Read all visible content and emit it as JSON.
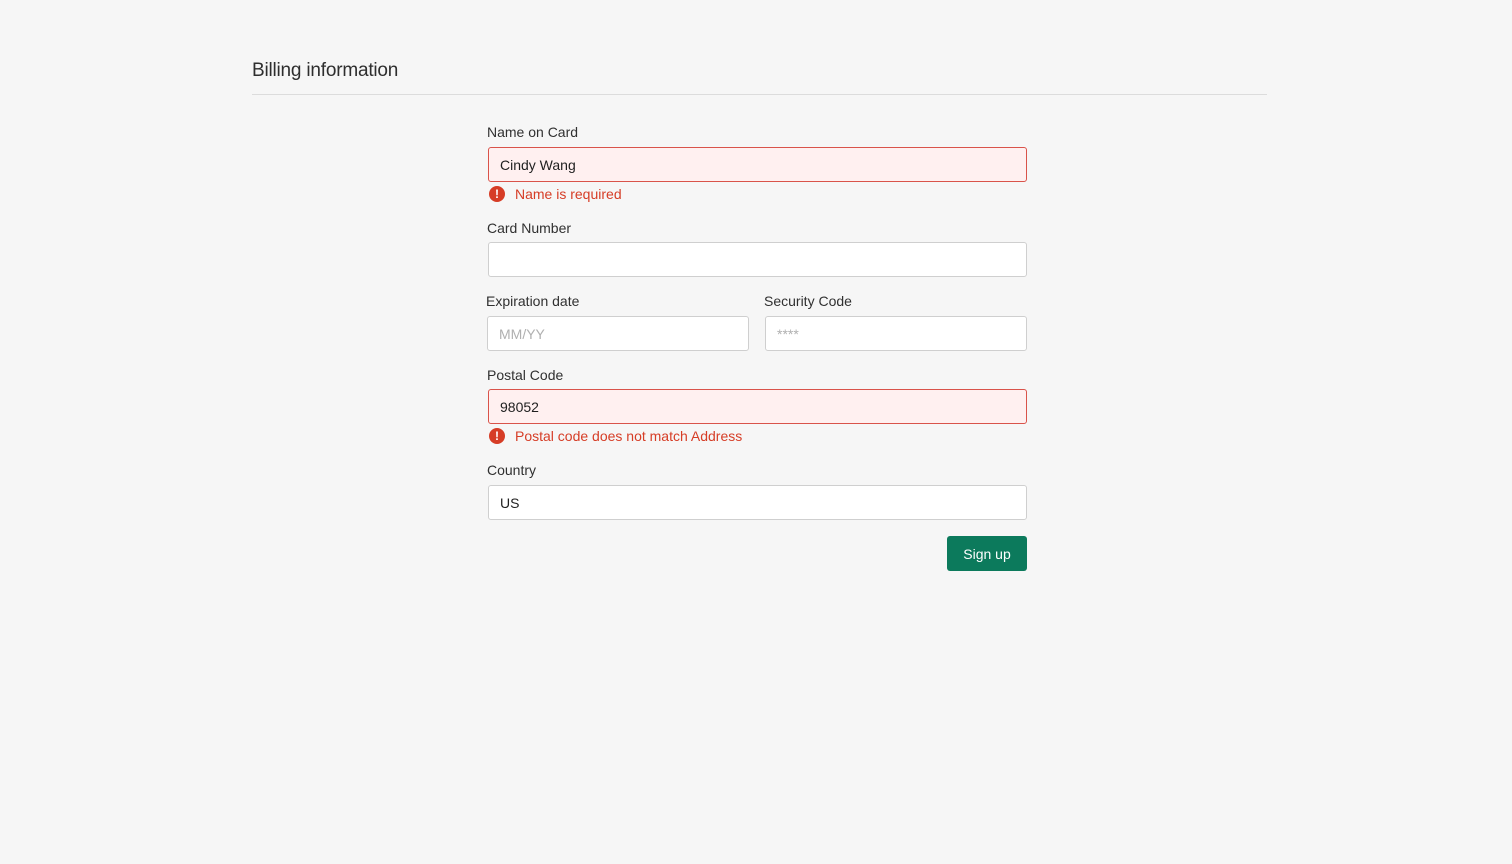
{
  "header": {
    "title": "Billing information"
  },
  "form": {
    "name_on_card": {
      "label": "Name on Card",
      "value": "Cindy Wang",
      "error": "Name is required"
    },
    "card_number": {
      "label": "Card Number",
      "value": ""
    },
    "expiration_date": {
      "label": "Expiration date",
      "value": "",
      "placeholder": "MM/YY"
    },
    "security_code": {
      "label": "Security Code",
      "value": "",
      "placeholder": "****"
    },
    "postal_code": {
      "label": "Postal Code",
      "value": "98052",
      "error": "Postal code does not match Address"
    },
    "country": {
      "label": "Country",
      "value": "US"
    },
    "submit_label": "Sign up"
  },
  "icons": {
    "error": "exclamation-circle-icon"
  },
  "colors": {
    "background": "#f6f6f6",
    "error": "#d63d26",
    "error_field_bg": "#fff0f0",
    "primary_button": "#0c7a5c"
  }
}
